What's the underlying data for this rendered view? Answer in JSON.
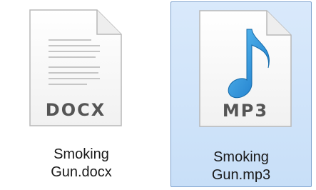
{
  "files": [
    {
      "type_label": "DOCX",
      "name_line1": "Smoking",
      "name_line2": "Gun.docx",
      "icon": "docx-file-icon",
      "selected": false
    },
    {
      "type_label": "MP3",
      "name_line1": "Smoking",
      "name_line2": "Gun.mp3",
      "icon": "mp3-file-icon",
      "selected": true
    }
  ],
  "colors": {
    "selection_fill": "#cfe3fa",
    "selection_border": "#7da2ce",
    "note_blue": "#1f8fd6",
    "label_gray": "#555555"
  }
}
